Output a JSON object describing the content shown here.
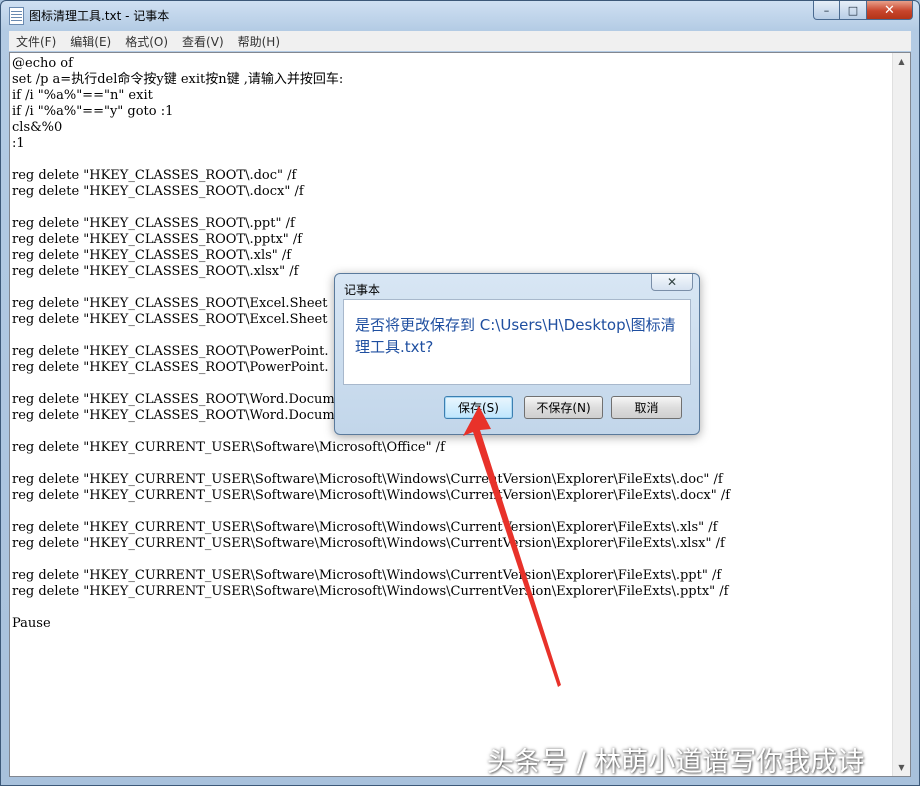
{
  "window": {
    "title": "图标清理工具.txt - 记事本",
    "controls": {
      "minimize": "–",
      "maximize": "□",
      "close": "✕"
    }
  },
  "menu": [
    "文件(F)",
    "编辑(E)",
    "格式(O)",
    "查看(V)",
    "帮助(H)"
  ],
  "editor": {
    "lines": [
      "@echo of",
      "set /p a=执行del命令按y键 exit按n键 ,请输入并按回车:",
      "if /i \"%a%\"==\"n\" exit",
      "if /i \"%a%\"==\"y\" goto :1",
      "cls&%0",
      ":1",
      "",
      "reg delete \"HKEY_CLASSES_ROOT\\.doc\" /f",
      "reg delete \"HKEY_CLASSES_ROOT\\.docx\" /f",
      "",
      "reg delete \"HKEY_CLASSES_ROOT\\.ppt\" /f",
      "reg delete \"HKEY_CLASSES_ROOT\\.pptx\" /f",
      "reg delete \"HKEY_CLASSES_ROOT\\.xls\" /f",
      "reg delete \"HKEY_CLASSES_ROOT\\.xlsx\" /f",
      "",
      "reg delete \"HKEY_CLASSES_ROOT\\Excel.Sheet",
      "reg delete \"HKEY_CLASSES_ROOT\\Excel.Sheet",
      "",
      "reg delete \"HKEY_CLASSES_ROOT\\PowerPoint.",
      "reg delete \"HKEY_CLASSES_ROOT\\PowerPoint.",
      "",
      "reg delete \"HKEY_CLASSES_ROOT\\Word.Docume",
      "reg delete \"HKEY_CLASSES_ROOT\\Word.Docume",
      "",
      "reg delete \"HKEY_CURRENT_USER\\Software\\Microsoft\\Office\" /f",
      "",
      "reg delete \"HKEY_CURRENT_USER\\Software\\Microsoft\\Windows\\CurrentVersion\\Explorer\\FileExts\\.doc\" /f",
      "reg delete \"HKEY_CURRENT_USER\\Software\\Microsoft\\Windows\\CurrentVersion\\Explorer\\FileExts\\.docx\" /f",
      "",
      "reg delete \"HKEY_CURRENT_USER\\Software\\Microsoft\\Windows\\CurrentVersion\\Explorer\\FileExts\\.xls\" /f",
      "reg delete \"HKEY_CURRENT_USER\\Software\\Microsoft\\Windows\\CurrentVersion\\Explorer\\FileExts\\.xlsx\" /f",
      "",
      "reg delete \"HKEY_CURRENT_USER\\Software\\Microsoft\\Windows\\CurrentVersion\\Explorer\\FileExts\\.ppt\" /f",
      "reg delete \"HKEY_CURRENT_USER\\Software\\Microsoft\\Windows\\CurrentVersion\\Explorer\\FileExts\\.pptx\" /f",
      "",
      "Pause"
    ]
  },
  "dialog": {
    "title": "记事本",
    "close": "✕",
    "message": "是否将更改保存到 C:\\Users\\H\\Desktop\\图标清理工具.txt?",
    "buttons": {
      "save": "保存(S)",
      "dont_save": "不保存(N)",
      "cancel": "取消"
    }
  },
  "annotation": {
    "arrow_color": "#e8322a",
    "points_to": "save-button"
  },
  "watermark": "头条号 / 林萌小道谱写你我成诗"
}
